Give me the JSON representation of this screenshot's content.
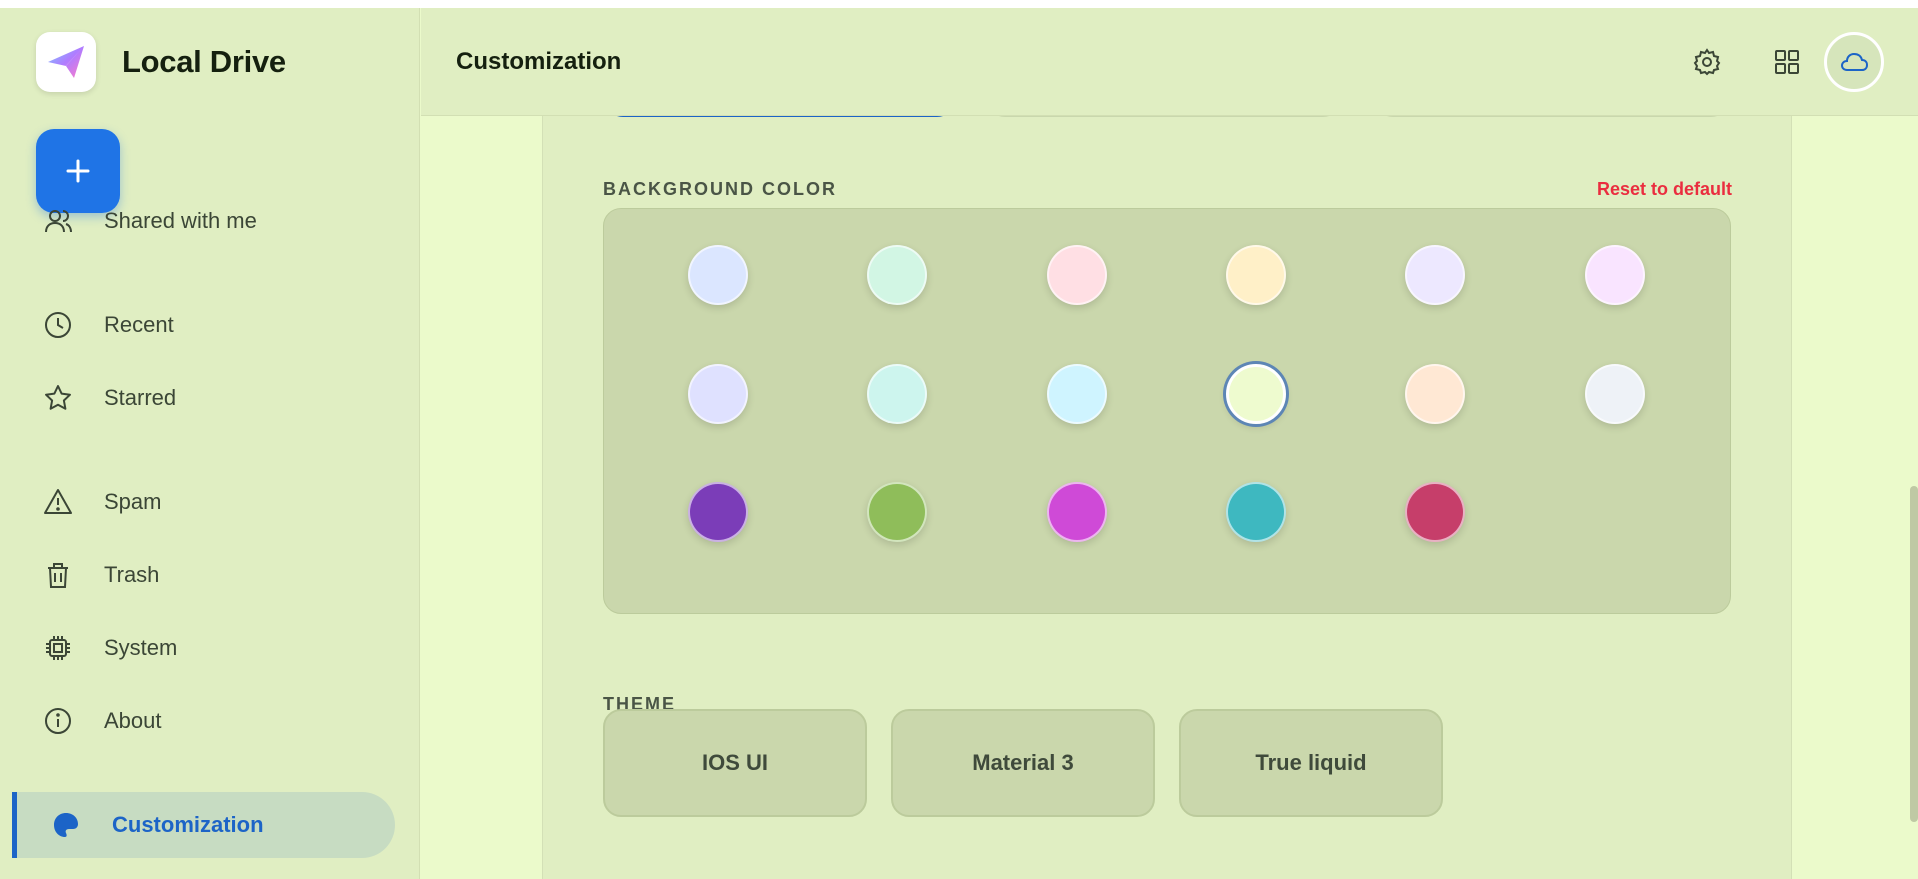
{
  "app": {
    "name": "Local Drive"
  },
  "header": {
    "title": "Customization"
  },
  "fab": {
    "icon": "plus-icon"
  },
  "sidebar": {
    "items": [
      {
        "label": "Shared with me",
        "icon": "people-icon"
      },
      {
        "label": "Recent",
        "icon": "clock-icon"
      },
      {
        "label": "Starred",
        "icon": "star-icon"
      },
      {
        "label": "Spam",
        "icon": "warning-icon"
      },
      {
        "label": "Trash",
        "icon": "trash-icon"
      },
      {
        "label": "System",
        "icon": "chip-icon"
      },
      {
        "label": "About",
        "icon": "info-icon"
      },
      {
        "label": "Customization",
        "icon": "palette-icon",
        "active": true
      }
    ]
  },
  "background_color": {
    "title": "BACKGROUND COLOR",
    "reset_label": "Reset to default",
    "selected_index": 9,
    "swatches": [
      "#dbe6ff",
      "#d2f6e4",
      "#ffdfe4",
      "#fff0c8",
      "#ede8ff",
      "#f9e4ff",
      "#dfe1ff",
      "#cdf5ee",
      "#cff4ff",
      "#eefbcf",
      "#ffe8d4",
      "#eef2f7",
      "#7b3db8",
      "#8fbd5a",
      "#cf4ad7",
      "#3eb8c0",
      "#c63e6a"
    ]
  },
  "theme": {
    "title": "THEME",
    "options": [
      {
        "label": "IOS UI"
      },
      {
        "label": "Material 3"
      },
      {
        "label": "True liquid"
      }
    ]
  },
  "colors": {
    "accent": "#1c64c7",
    "fab": "#1f74e6",
    "reset": "#ea2d3f",
    "app_bg": "#ebfacb",
    "chrome_bg": "#e0eec2"
  }
}
